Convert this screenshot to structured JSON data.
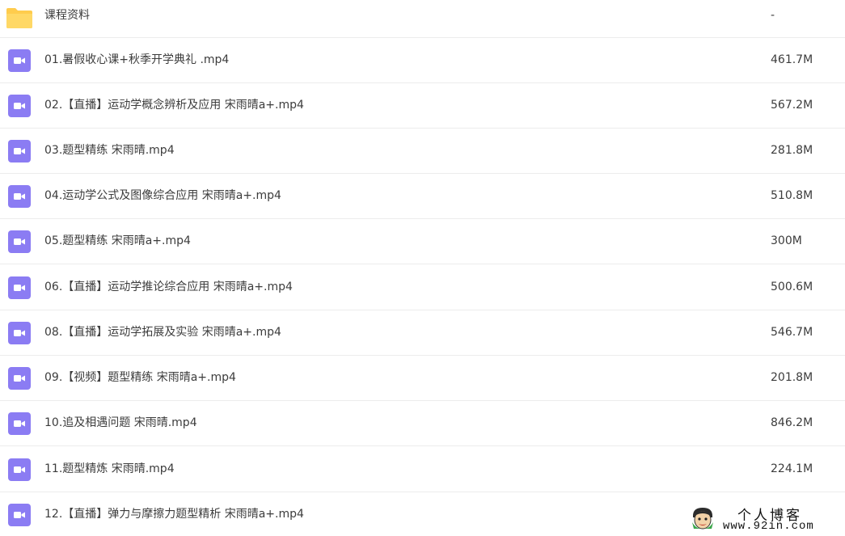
{
  "colors": {
    "video_icon": "#8b7cf3",
    "folder_icon": "#ffcc4d",
    "text": "#3c3c3c",
    "separator": "#ececec"
  },
  "files": [
    {
      "icon": "folder-icon",
      "name": "课程资料",
      "size": "-"
    },
    {
      "icon": "video-file-icon",
      "name": "01.暑假收心课+秋季开学典礼 .mp4",
      "size": "461.7M"
    },
    {
      "icon": "video-file-icon",
      "name": "02.【直播】运动学概念辨析及应用 宋雨晴a+.mp4",
      "size": "567.2M"
    },
    {
      "icon": "video-file-icon",
      "name": "03.题型精练 宋雨晴.mp4",
      "size": "281.8M"
    },
    {
      "icon": "video-file-icon",
      "name": "04.运动学公式及图像综合应用 宋雨晴a+.mp4",
      "size": "510.8M"
    },
    {
      "icon": "video-file-icon",
      "name": "05.题型精练 宋雨晴a+.mp4",
      "size": "300M"
    },
    {
      "icon": "video-file-icon",
      "name": "06.【直播】运动学推论综合应用 宋雨晴a+.mp4",
      "size": "500.6M"
    },
    {
      "icon": "video-file-icon",
      "name": "08.【直播】运动学拓展及实验 宋雨晴a+.mp4",
      "size": "546.7M"
    },
    {
      "icon": "video-file-icon",
      "name": "09.【视频】题型精练 宋雨晴a+.mp4",
      "size": "201.8M"
    },
    {
      "icon": "video-file-icon",
      "name": "10.追及相遇问题 宋雨晴.mp4",
      "size": "846.2M"
    },
    {
      "icon": "video-file-icon",
      "name": "11.题型精炼 宋雨晴.mp4",
      "size": "224.1M"
    },
    {
      "icon": "video-file-icon",
      "name": "12.【直播】弹力与摩擦力题型精析 宋雨晴a+.mp4",
      "size": ""
    }
  ],
  "watermark": {
    "title": "个人博客",
    "url": "www.92in.com"
  }
}
